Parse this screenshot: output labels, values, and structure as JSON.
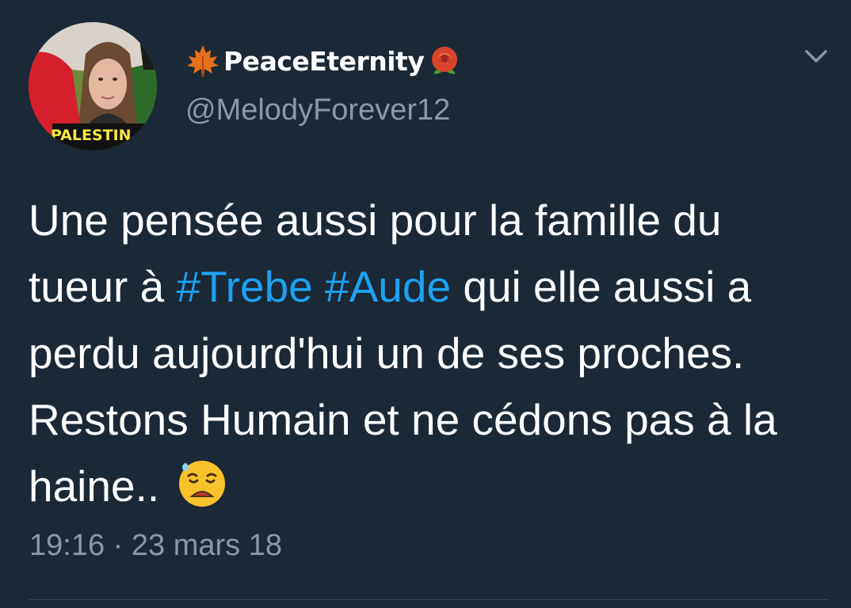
{
  "author": {
    "display_name": "PeaceEternity",
    "handle": "@MelodyForever12",
    "name_prefix_icon": "maple-leaf-icon",
    "name_suffix_icon": "rose-icon",
    "avatar_badge_text": "PALESTIN"
  },
  "tweet": {
    "text_part1": "Une pensée aussi pour la famille du tueur à ",
    "hashtag1": "#Trebe",
    "text_space": " ",
    "hashtag2": "#Aude",
    "text_part2": " qui elle aussi a perdu aujourd'hui un de ses proches. Restons Humain et ne cédons pas à la haine.. ",
    "end_emoji": "disappointed-relieved-face-icon"
  },
  "meta": {
    "timestamp": "19:16 · 23 mars 18"
  },
  "colors": {
    "background": "#1b2836",
    "text": "#ffffff",
    "secondary": "#8b98a5",
    "link": "#1da1f2"
  }
}
